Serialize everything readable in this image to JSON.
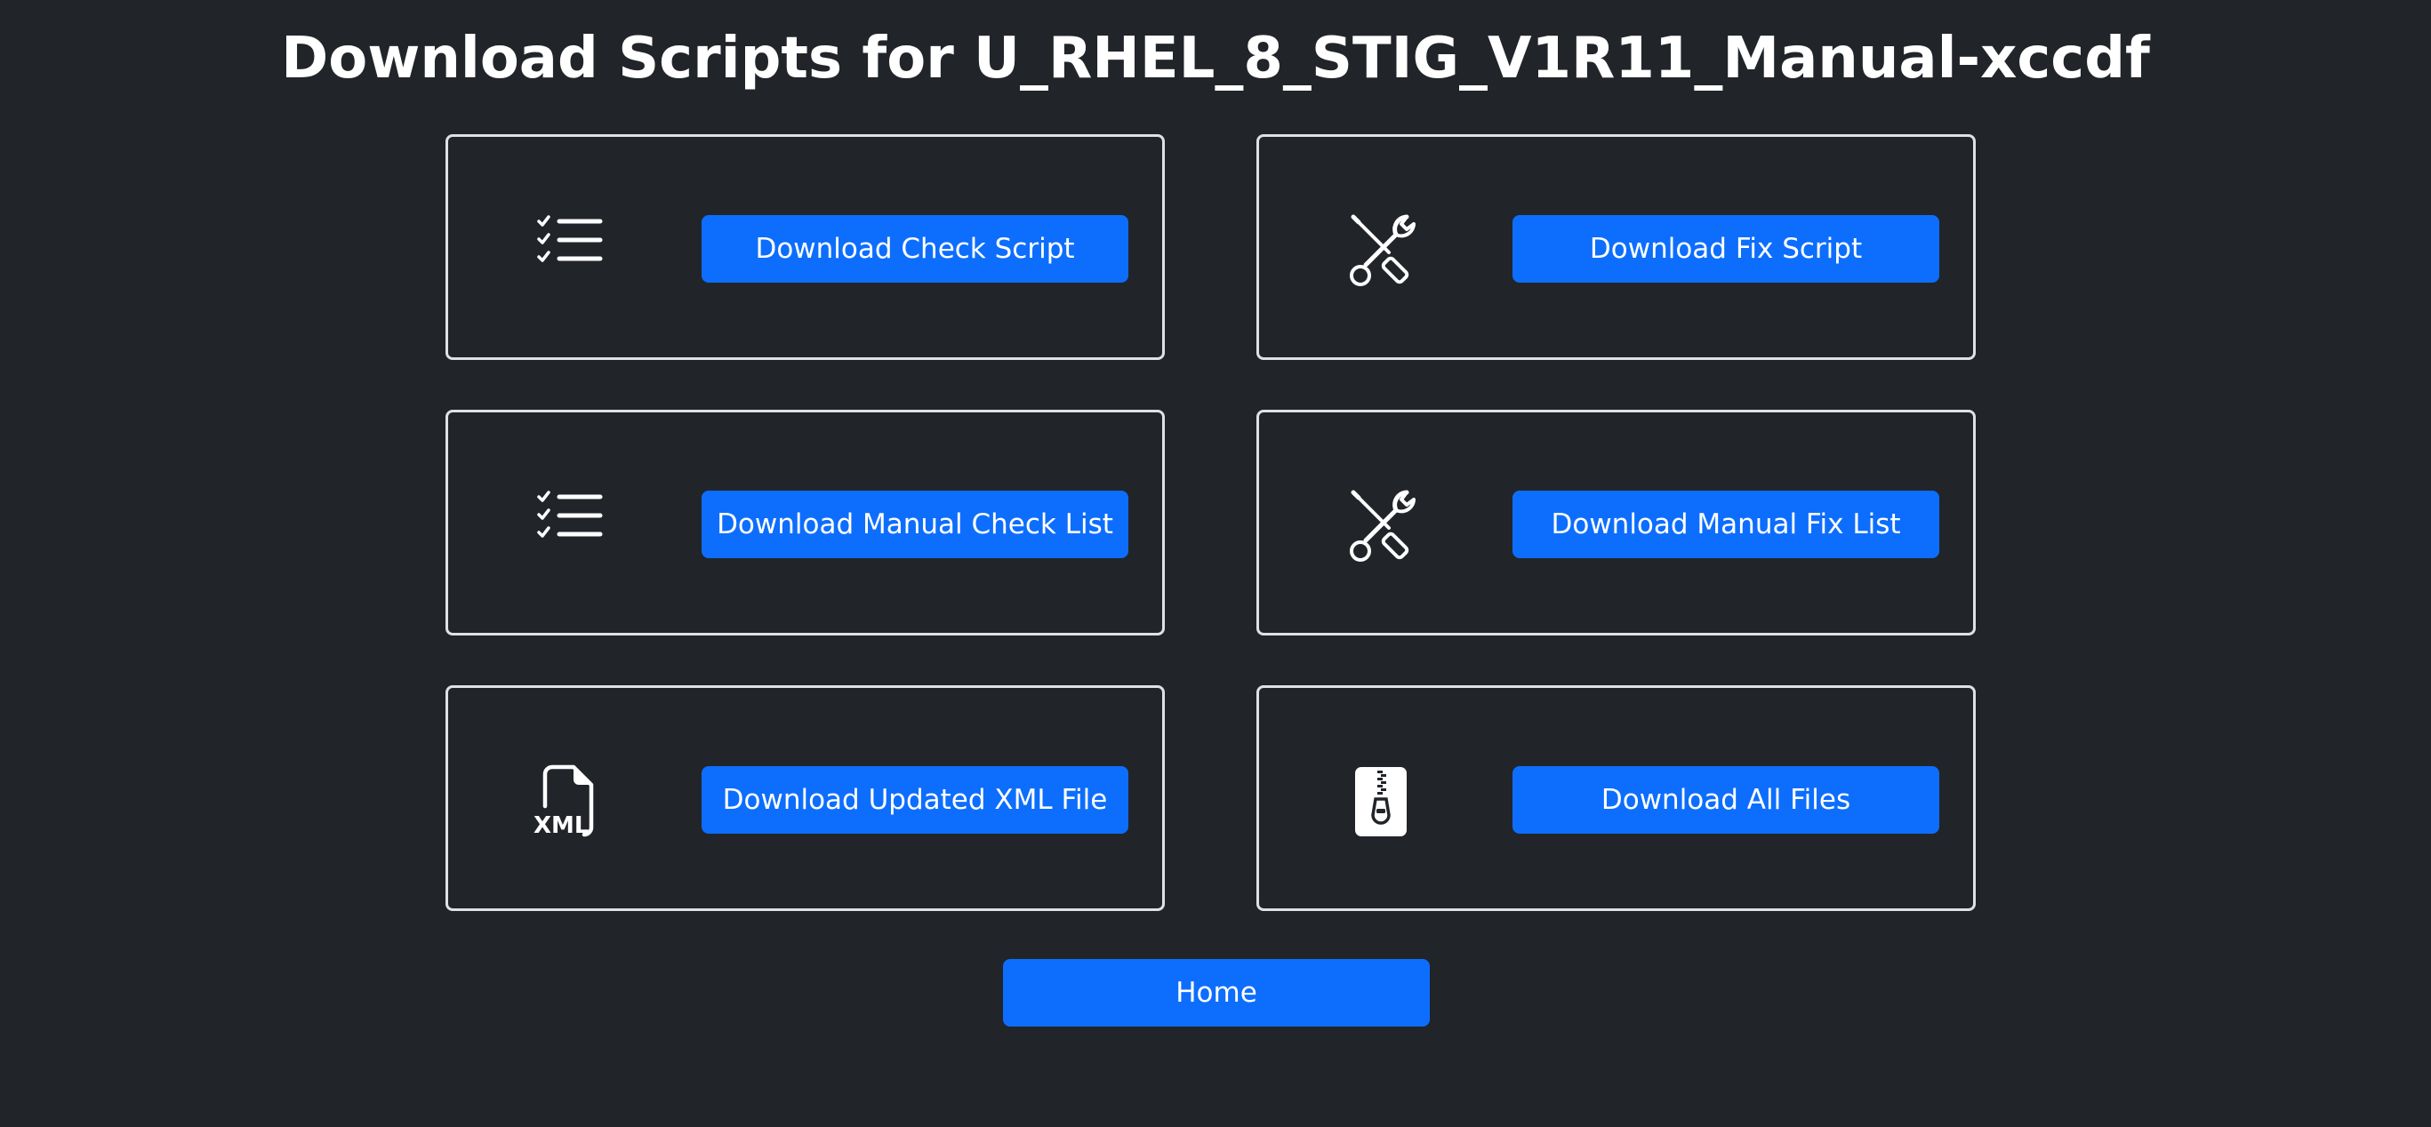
{
  "page": {
    "title": "Download Scripts for U_RHEL_8_STIG_V1R11_Manual-xccdf"
  },
  "cards": {
    "check_script": {
      "icon": "checklist-icon",
      "button_label": "Download Check Script"
    },
    "fix_script": {
      "icon": "tools-icon",
      "button_label": "Download Fix Script"
    },
    "manual_check_list": {
      "icon": "checklist-icon",
      "button_label": "Download Manual Check List"
    },
    "manual_fix_list": {
      "icon": "tools-icon",
      "button_label": "Download Manual Fix List"
    },
    "updated_xml": {
      "icon": "xml-file-icon",
      "icon_text": "XML",
      "button_label": "Download Updated XML File"
    },
    "all_files": {
      "icon": "zip-file-icon",
      "button_label": "Download All Files"
    }
  },
  "footer": {
    "home_label": "Home"
  },
  "colors": {
    "background": "#212529",
    "primary": "#0d6efd",
    "card_border": "#dee2e6",
    "text": "#ffffff"
  }
}
